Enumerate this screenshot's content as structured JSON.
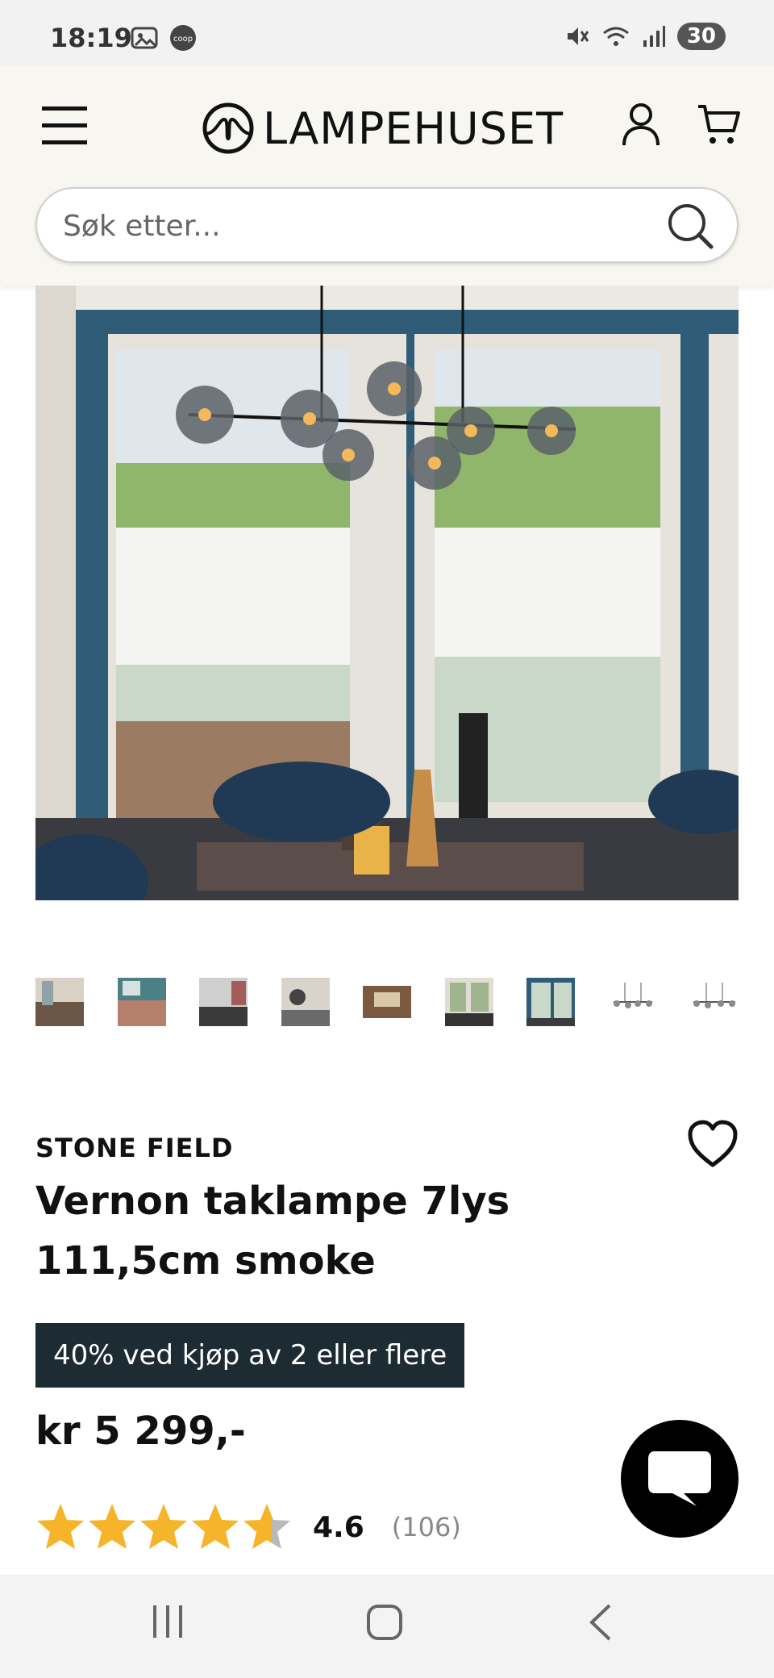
{
  "status_bar": {
    "time": "18:19",
    "battery": "30",
    "icons": [
      "gallery-icon",
      "coop-app-icon",
      "mute-icon",
      "wifi-icon",
      "signal-icon"
    ]
  },
  "header": {
    "logo_text": "LAMPEHUSET",
    "search_placeholder": "Søk etter..."
  },
  "gallery": {
    "thumbnail_count": 9,
    "selected_index": 0
  },
  "product": {
    "brand": "STONE FIELD",
    "title": "Vernon taklampe 7lys 111,5cm smoke",
    "promo": "40% ved kjøp av 2 eller flere",
    "price": "kr 5 299,-",
    "rating": {
      "value": "4.6",
      "count": "(106)",
      "stars": 4.6
    }
  },
  "colors": {
    "header_bg": "#f8f6f0",
    "promo_bg": "#1d2b32",
    "star": "#f5b42a",
    "wall": "#2f5c76"
  }
}
